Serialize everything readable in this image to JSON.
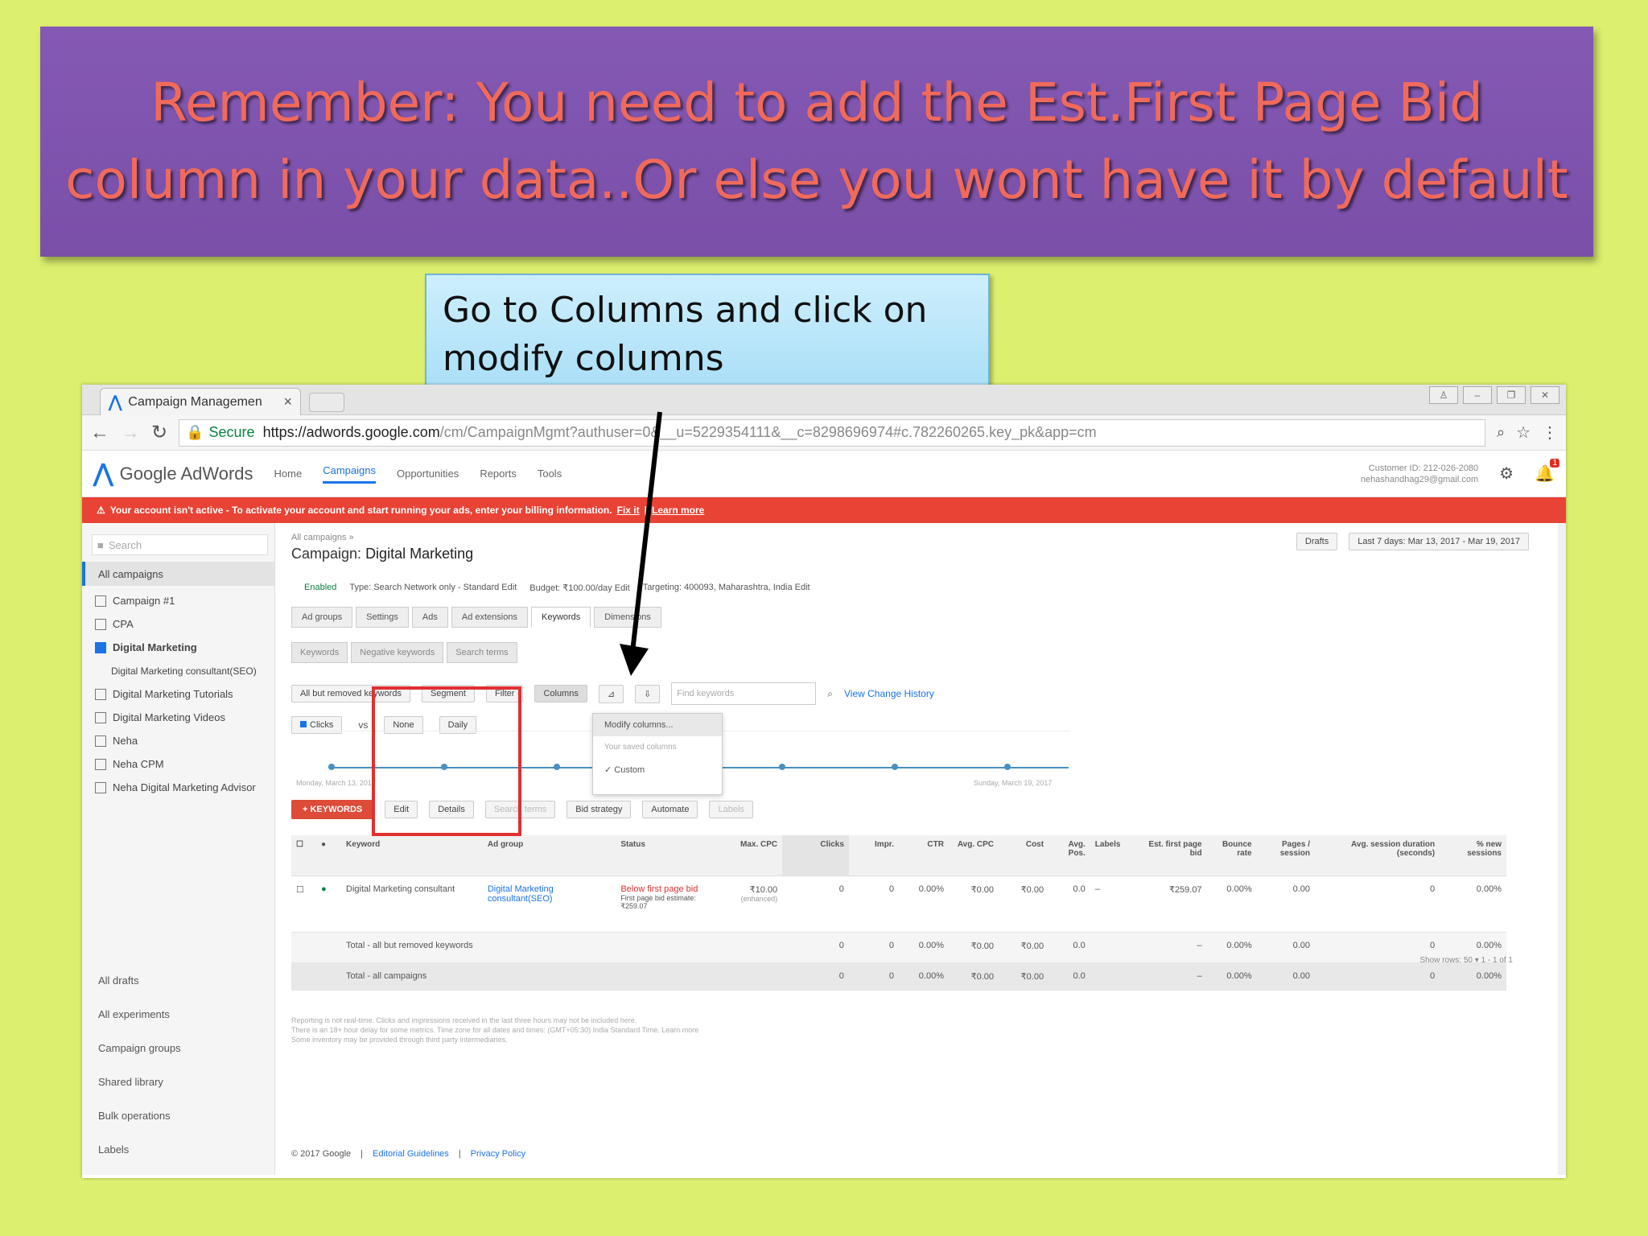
{
  "banner": {
    "line1": "Remember: You need to add the Est.First Page Bid",
    "line2": "column in your data..Or else  you wont have it by default"
  },
  "callout": {
    "line1": "Go to Columns and click on",
    "line2": "modify columns"
  },
  "browser": {
    "tab_title": "Campaign Managemen",
    "url_secure": "Secure",
    "url_host": "https://adwords.google.com",
    "url_path": "/cm/CampaignMgmt?authuser=0&__u=5229354111&__c=8298696974#c.782260265.key_pk&app=cm"
  },
  "adwords": {
    "brand": "Google AdWords",
    "nav": [
      "Home",
      "Campaigns",
      "Opportunities",
      "Reports",
      "Tools"
    ],
    "customer_id": "Customer ID: 212-026-2080",
    "email": "nehashandhag29@gmail.com",
    "alert_text": "Your account isn't active - To activate your account and start running your ads, enter your billing information.",
    "alert_fix": "Fix it",
    "alert_learn": "Learn more"
  },
  "sidebar": {
    "search_placeholder": "Search",
    "all_campaigns": "All campaigns",
    "items": [
      {
        "label": "Campaign #1"
      },
      {
        "label": "CPA"
      },
      {
        "label": "Digital Marketing"
      },
      {
        "label": "Digital Marketing consultant(SEO)"
      },
      {
        "label": "Digital Marketing Tutorials"
      },
      {
        "label": "Digital Marketing Videos"
      },
      {
        "label": "Neha"
      },
      {
        "label": "Neha CPM"
      },
      {
        "label": "Neha Digital Marketing Advisor"
      }
    ],
    "bottom": [
      "All drafts",
      "All experiments",
      "Campaign groups",
      "Shared library",
      "Bulk operations",
      "Labels"
    ]
  },
  "main": {
    "crumb": "All campaigns »",
    "title_prefix": "Campaign:",
    "title": "Digital Marketing",
    "drafts_btn": "Drafts",
    "date_range": "Last 7 days: Mar 13, 2017 - Mar 19, 2017",
    "status": "Enabled",
    "type": "Type: Search Network only - Standard  Edit",
    "budget": "Budget: ₹100.00/day  Edit",
    "targeting": "Targeting: 400093, Maharashtra, India  Edit",
    "tabs": [
      "Ad groups",
      "Settings",
      "Ads",
      "Ad extensions",
      "Keywords",
      "Dimensions"
    ],
    "subtabs": [
      "Keywords",
      "Negative keywords",
      "Search terms"
    ],
    "filter_all": "All but removed keywords",
    "segment": "Segment",
    "filter": "Filter",
    "columns": "Columns",
    "find_placeholder": "Find keywords",
    "view_history": "View Change History",
    "metric1": "Clicks",
    "vs": "vs",
    "metric2": "None",
    "period": "Daily",
    "chart_start": "Monday, March 13, 2017",
    "chart_end": "Sunday, March 19, 2017",
    "dropdown": {
      "modify": "Modify columns...",
      "saved": "Your saved columns",
      "custom": "✓ Custom"
    },
    "actions": {
      "add_keywords": "+ KEYWORDS",
      "edit": "Edit",
      "details": "Details",
      "search_terms": "Search terms",
      "bid_strategy": "Bid strategy",
      "automate": "Automate",
      "labels": "Labels"
    },
    "table": {
      "headers": [
        "Keyword",
        "Ad group",
        "Status",
        "Max. CPC",
        "Clicks",
        "Impr.",
        "CTR",
        "Avg. CPC",
        "Cost",
        "Avg. Pos.",
        "Labels",
        "Est. first page bid",
        "Bounce rate",
        "Pages / session",
        "Avg. session duration (seconds)",
        "% new sessions"
      ],
      "row": {
        "keyword": "Digital Marketing consultant",
        "adgroup": "Digital Marketing consultant(SEO)",
        "status": "Below first page bid",
        "status_note": "First page bid estimate: ₹259.07",
        "maxcpc": "₹10.00",
        "maxcpc_note": "(enhanced)",
        "clicks": "0",
        "impr": "0",
        "ctr": "0.00%",
        "avgcpc": "₹0.00",
        "cost": "₹0.00",
        "avgpos": "0.0",
        "labels": "–",
        "est": "₹259.07",
        "bounce": "0.00%",
        "pages": "0.00",
        "duration": "0",
        "newsess": "0.00%"
      },
      "total1": {
        "label": "Total - all but removed keywords",
        "clicks": "0",
        "impr": "0",
        "ctr": "0.00%",
        "avgcpc": "₹0.00",
        "cost": "₹0.00",
        "avgpos": "0.0",
        "est": "–",
        "bounce": "0.00%",
        "pages": "0.00",
        "duration": "0",
        "newsess": "0.00%"
      },
      "total2": {
        "label": "Total - all campaigns",
        "clicks": "0",
        "impr": "0",
        "ctr": "0.00%",
        "avgcpc": "₹0.00",
        "cost": "₹0.00",
        "avgpos": "0.0",
        "est": "–",
        "bounce": "0.00%",
        "pages": "0.00",
        "duration": "0",
        "newsess": "0.00%"
      }
    },
    "pager": "Show rows: 50  ▾   1 - 1 of 1",
    "footnote1": "Reporting is not real-time. Clicks and impressions received in the last three hours may not be included here.",
    "footnote2": "There is an 18+ hour delay for some metrics. Time zone for all dates and times: (GMT+05:30) India Standard Time.  Learn more",
    "footnote3": "Some inventory may be provided through third party intermediaries.",
    "copyright": "© 2017 Google",
    "editorial": "Editorial Guidelines",
    "privacy": "Privacy Policy"
  },
  "colors": {
    "background": "#dcef6e",
    "banner": "#7f55ad",
    "banner_text": "#f06a5b",
    "callout": "#b8e4f9",
    "alert": "#e84335",
    "highlight_box": "#e03030"
  }
}
